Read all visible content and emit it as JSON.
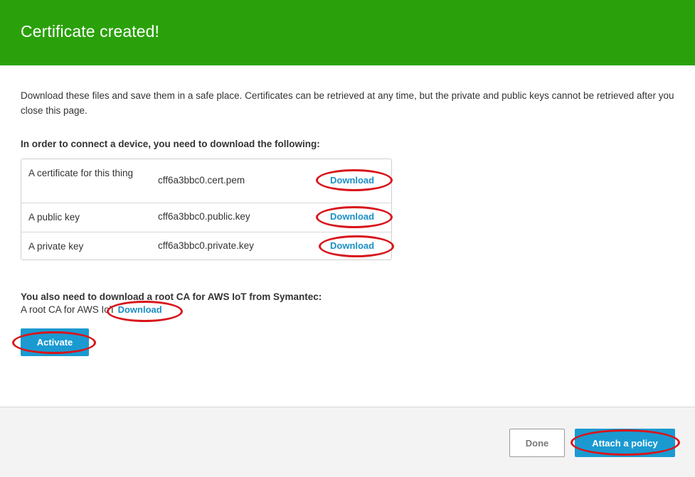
{
  "header": {
    "title": "Certificate created!"
  },
  "intro": "Download these files and save them in a safe place. Certificates can be retrieved at any time, but the private and public keys cannot be retrieved after you close this page.",
  "files_section": {
    "title": "In order to connect a device, you need to download the following:",
    "rows": [
      {
        "description": "A certificate for this thing",
        "filename": "cff6a3bbc0.cert.pem",
        "action": "Download"
      },
      {
        "description": "A public key",
        "filename": "cff6a3bbc0.public.key",
        "action": "Download"
      },
      {
        "description": "A private key",
        "filename": "cff6a3bbc0.private.key",
        "action": "Download"
      }
    ]
  },
  "root_ca": {
    "title": "You also need to download a root CA for AWS IoT from Symantec:",
    "label": "A root CA for AWS IoT",
    "action": "Download"
  },
  "activate_label": "Activate",
  "footer": {
    "done_label": "Done",
    "attach_label": "Attach a policy"
  },
  "colors": {
    "header_bg": "#2aa10a",
    "link": "#1a8fc4",
    "primary_button": "#1a9ad1",
    "highlight_ring": "#d8151b"
  }
}
